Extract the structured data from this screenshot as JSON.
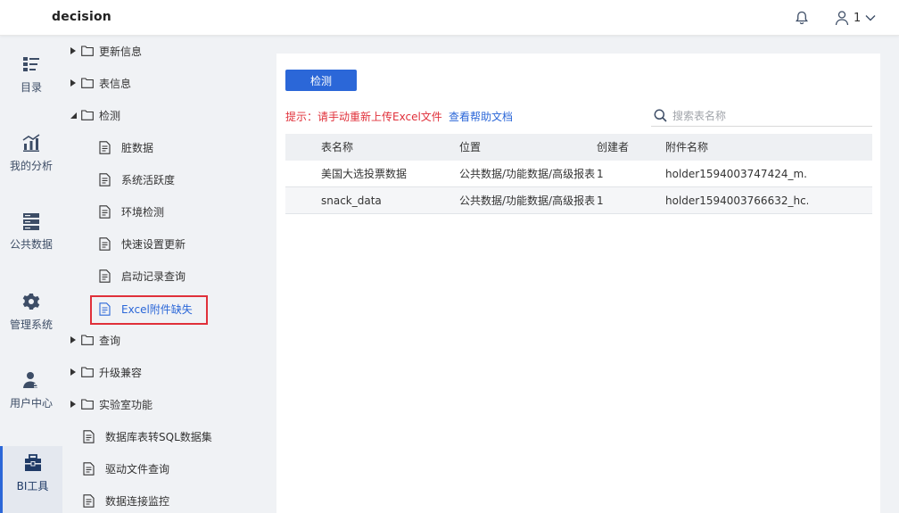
{
  "header": {
    "brand": "decision",
    "user_name": "1"
  },
  "rail": [
    {
      "label": "目录",
      "icon": "catalog-icon"
    },
    {
      "label": "我的分析",
      "icon": "analysis-icon"
    },
    {
      "label": "公共数据",
      "icon": "data-icon"
    },
    {
      "label": "管理系统",
      "icon": "gear-icon"
    },
    {
      "label": "用户中心",
      "icon": "user-center-icon"
    },
    {
      "label": "BI工具",
      "icon": "toolbox-icon",
      "active": true
    }
  ],
  "tree": {
    "update_info": "更新信息",
    "table_info": "表信息",
    "detect": "检测",
    "children": [
      "脏数据",
      "系统活跃度",
      "环境检测",
      "快速设置更新",
      "启动记录查询",
      "Excel附件缺失"
    ],
    "query": "查询",
    "upgrade": "升级兼容",
    "lab": "实验室功能",
    "db_to_sql": "数据库表转SQL数据集",
    "driver_query": "驱动文件查询",
    "conn_monitor": "数据连接监控"
  },
  "main": {
    "detect_button": "检测",
    "hint": "提示：请手动重新上传Excel文件",
    "help_link": "查看帮助文档",
    "search_placeholder": "搜索表名称",
    "columns": [
      "表名称",
      "位置",
      "创建者",
      "附件名称"
    ],
    "rows": [
      [
        "美国大选投票数据",
        "公共数据/功能数据/高级报表",
        "1",
        "holder1594003747424_m..."
      ],
      [
        "snack_data",
        "公共数据/功能数据/高级报表",
        "1",
        "holder1594003766632_hc..."
      ]
    ]
  },
  "colors": {
    "accent": "#2b67d8",
    "warning": "#e0303a",
    "rail_bg": "#f0f2f5"
  }
}
